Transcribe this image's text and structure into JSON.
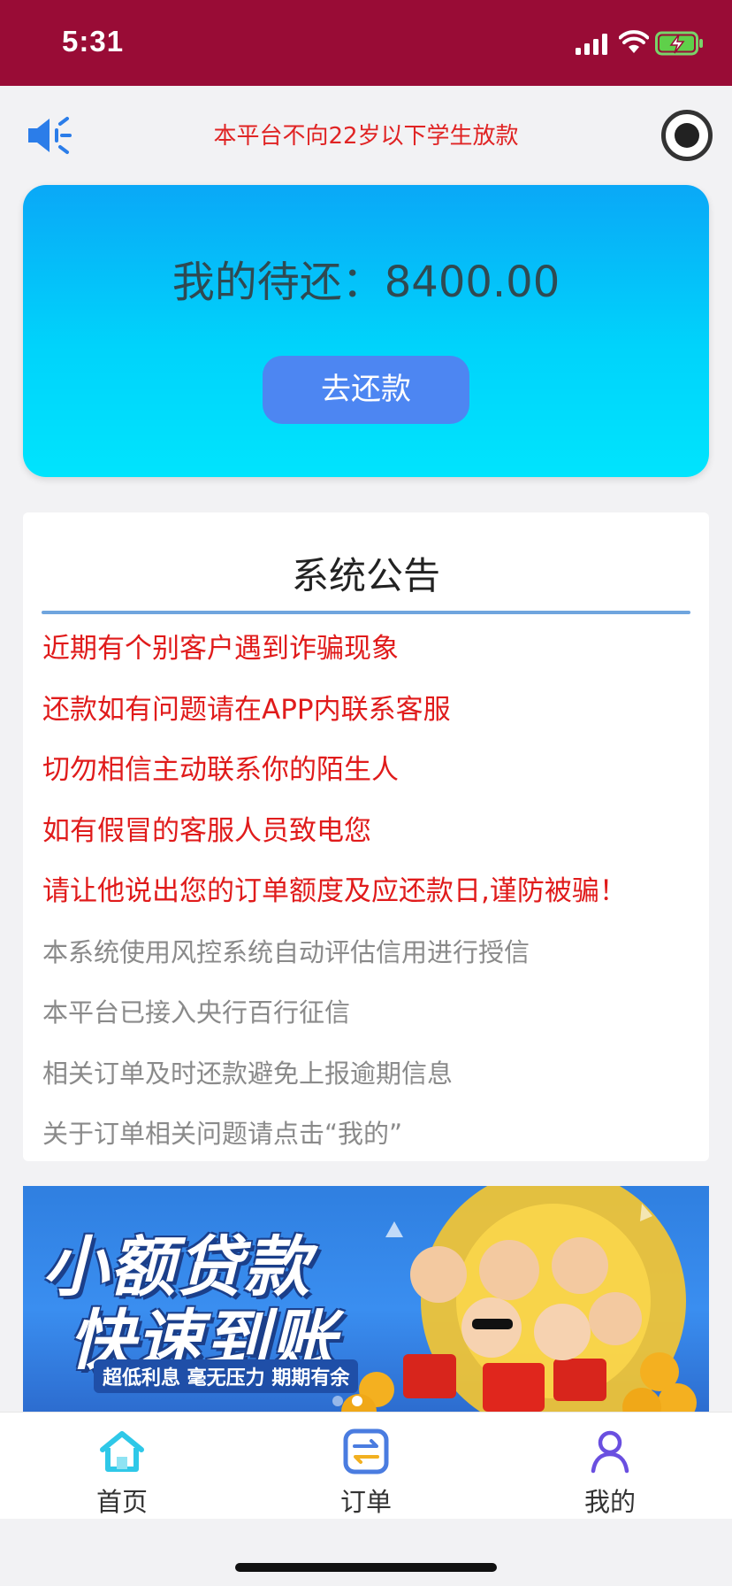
{
  "status_bar": {
    "time": "5:31"
  },
  "notice": {
    "text": "本平台不向22岁以下学生放款"
  },
  "balance": {
    "label": "我的待还：",
    "amount": "8400.00",
    "repay_button": "去还款",
    "gradient_top": "#0aa8f7",
    "gradient_bottom": "#00e4fd",
    "button_color": "#4d86f2"
  },
  "announcement": {
    "title": "系统公告",
    "items": [
      {
        "text": "近期有个别客户遇到诈骗现象",
        "color": "red"
      },
      {
        "text": "还款如有问题请在APP内联系客服",
        "color": "red"
      },
      {
        "text": "切勿相信主动联系你的陌生人",
        "color": "red"
      },
      {
        "text": "如有假冒的客服人员致电您",
        "color": "red"
      },
      {
        "text": "请让他说出您的订单额度及应还款日,谨防被骗！",
        "color": "red"
      },
      {
        "text": "本系统使用风控系统自动评估信用进行授信",
        "color": "grey"
      },
      {
        "text": "本平台已接入央行百行征信",
        "color": "grey"
      },
      {
        "text": "相关订单及时还款避免上报逾期信息",
        "color": "grey"
      },
      {
        "text": "关于订单相关问题请点击“我的”",
        "color": "grey"
      }
    ]
  },
  "banner": {
    "headline_1": "小额贷款",
    "headline_2": "快速到账",
    "tagline": "超低利息 毫无压力 期期有余"
  },
  "tabbar": {
    "items": [
      {
        "label": "首页",
        "icon": "home-icon"
      },
      {
        "label": "订单",
        "icon": "orders-icon"
      },
      {
        "label": "我的",
        "icon": "profile-icon"
      }
    ]
  },
  "colors": {
    "status_bar": "#990c36",
    "notice_red": "#e02424",
    "announce_red": "#e01b1b",
    "announce_grey": "#8a8a8a",
    "rule_blue": "#6fa5de"
  }
}
